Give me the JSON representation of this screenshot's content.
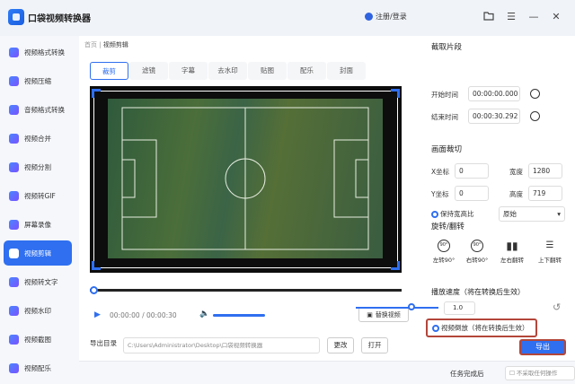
{
  "app": {
    "title": "口袋视频转换器",
    "login": "注册/登录"
  },
  "sidebar": {
    "items": [
      {
        "label": "视频格式转换"
      },
      {
        "label": "视频压缩"
      },
      {
        "label": "音频格式转换"
      },
      {
        "label": "视频合并"
      },
      {
        "label": "视频分割"
      },
      {
        "label": "视频转GIF"
      },
      {
        "label": "屏幕录像"
      },
      {
        "label": "视频剪辑"
      },
      {
        "label": "视频转文字"
      },
      {
        "label": "视频水印"
      },
      {
        "label": "视频截图"
      },
      {
        "label": "视频配乐"
      }
    ],
    "active_index": 7
  },
  "breadcrumb": {
    "home": "首页",
    "sep": "|",
    "current": "视频剪辑"
  },
  "tabs": [
    {
      "label": "裁剪"
    },
    {
      "label": "滤镜"
    },
    {
      "label": "字幕"
    },
    {
      "label": "去水印"
    },
    {
      "label": "贴图"
    },
    {
      "label": "配乐"
    },
    {
      "label": "封面"
    }
  ],
  "player": {
    "time": "00:00:00 / 00:00:30",
    "replace_label": "替换视频"
  },
  "output": {
    "label": "导出目录",
    "path": "C:\\Users\\Administrator\\Desktop\\口袋视频转换器",
    "change_label": "更改",
    "open_label": "打开"
  },
  "clip": {
    "title": "截取片段",
    "start_label": "开始时间",
    "start_value": "00:00:00.000",
    "end_label": "结束时间",
    "end_value": "00:00:30.292"
  },
  "crop": {
    "title": "画面裁切",
    "x_label": "X坐标",
    "x_value": "0",
    "y_label": "Y坐标",
    "y_value": "0",
    "w_label": "宽度",
    "w_value": "1280",
    "h_label": "高度",
    "h_value": "719",
    "aspect_label": "保持宽高比",
    "aspect_value": "原始"
  },
  "rotate": {
    "title": "旋转/翻转",
    "items": [
      {
        "label": "左转90°",
        "icon": "90°"
      },
      {
        "label": "右转90°",
        "icon": "90°"
      },
      {
        "label": "左右翻转"
      },
      {
        "label": "上下翻转"
      }
    ]
  },
  "speed": {
    "title": "播放速度（将在转换后生效）",
    "value": "1.0",
    "level": 0.62
  },
  "reverse": {
    "label": "视频倒放（将在转换后生效）"
  },
  "export": {
    "label": "导出"
  },
  "footer": {
    "label": "任务完成后",
    "select": "不采取任何操作"
  },
  "colors": {
    "accent": "#2f6ff0",
    "highlight": "#b3463a"
  }
}
